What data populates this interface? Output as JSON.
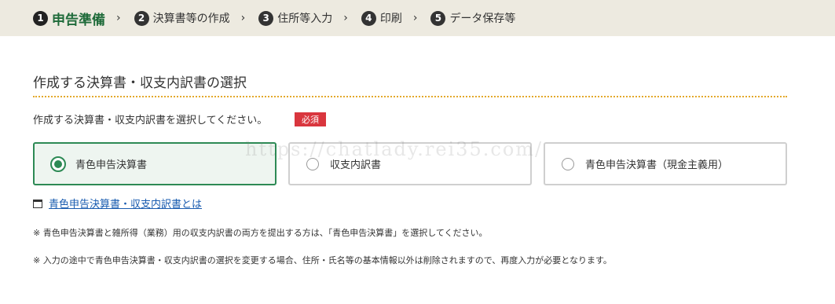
{
  "steps": [
    {
      "num": "1",
      "label": "申告準備"
    },
    {
      "num": "2",
      "label": "決算書等の作成"
    },
    {
      "num": "3",
      "label": "住所等入力"
    },
    {
      "num": "4",
      "label": "印刷"
    },
    {
      "num": "5",
      "label": "データ保存等"
    }
  ],
  "step_separator": "›",
  "section": {
    "title": "作成する決算書・収支内訳書の選択",
    "prompt": "作成する決算書・収支内訳書を選択してください。",
    "required_badge": "必須"
  },
  "options": [
    {
      "label": "青色申告決算書",
      "selected": true
    },
    {
      "label": "収支内訳書",
      "selected": false
    },
    {
      "label": "青色申告決算書（現金主義用）",
      "selected": false
    }
  ],
  "help_link": {
    "icon": "window-icon",
    "text": "青色申告決算書・収支内訳書とは"
  },
  "notes": [
    "※ 青色申告決算書と雑所得（業務）用の収支内訳書の両方を提出する方は、「青色申告決算書」を選択してください。",
    "※ 入力の途中で青色申告決算書・収支内訳書の選択を変更する場合、住所・氏名等の基本情報以外は削除されますので、再度入力が必要となります。"
  ],
  "watermark": "https://chatlady.rei35.com/",
  "colors": {
    "step_bar": "#edeae0",
    "active_step": "#1f6b3a",
    "selected_border": "#2d8a55",
    "required_badge": "#d9363e",
    "rule": "#e3a82b",
    "link": "#1a5cb0"
  }
}
